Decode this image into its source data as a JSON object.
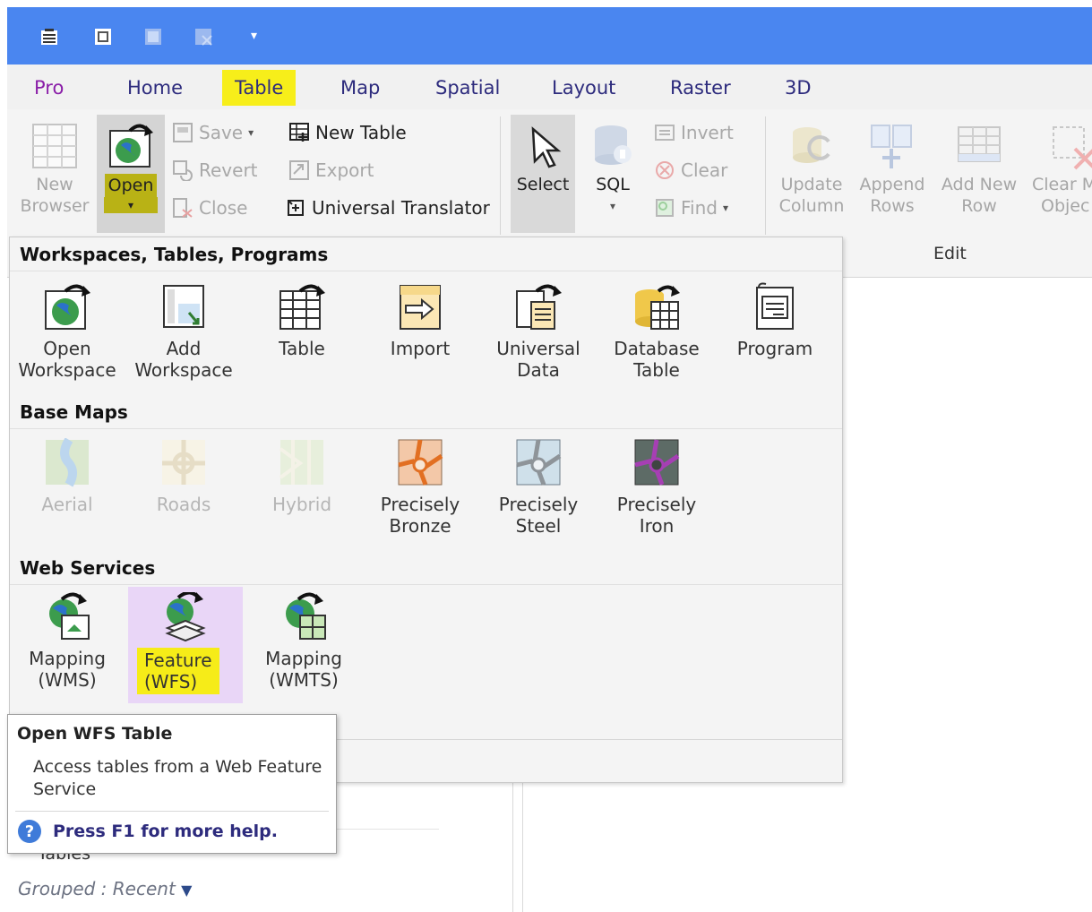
{
  "quick_access": {
    "icons": [
      "open-workspace-icon",
      "save-workspace-icon",
      "save-table-icon",
      "close-table-icon"
    ],
    "dropdown_glyph": "▾"
  },
  "tabs": [
    {
      "label": "Pro"
    },
    {
      "label": "Home"
    },
    {
      "label": "Table"
    },
    {
      "label": "Map"
    },
    {
      "label": "Spatial"
    },
    {
      "label": "Layout"
    },
    {
      "label": "Raster"
    },
    {
      "label": "3D"
    }
  ],
  "active_tab": "Table",
  "ribbon": {
    "new_browser": {
      "line1": "New",
      "line2": "Browser"
    },
    "open": {
      "label": "Open"
    },
    "save": "Save",
    "revert": "Revert",
    "close": "Close",
    "new_table": "New Table",
    "export": "Export",
    "universal_translator": "Universal Translator",
    "select": "Select",
    "sql": "SQL",
    "invert": "Invert",
    "clear": "Clear",
    "find": "Find",
    "update_column": {
      "line1": "Update",
      "line2": "Column"
    },
    "append_rows": {
      "line1": "Append",
      "line2": "Rows"
    },
    "add_new_row": {
      "line1": "Add New",
      "line2": "Row"
    },
    "clear_map_objects": {
      "line1": "Clear M",
      "line2": "Objec"
    },
    "edit_group": "Edit"
  },
  "dropdown": {
    "sections": {
      "workspaces": "Workspaces, Tables, Programs",
      "base_maps": "Base Maps",
      "web_services": "Web Services"
    },
    "workspace_items": [
      {
        "line1": "Open",
        "line2": "Workspace"
      },
      {
        "line1": "Add",
        "line2": "Workspace"
      },
      {
        "line1": "Table",
        "line2": ""
      },
      {
        "line1": "Import",
        "line2": ""
      },
      {
        "line1": "Universal",
        "line2": "Data"
      },
      {
        "line1": "Database",
        "line2": "Table"
      },
      {
        "line1": "Program",
        "line2": ""
      }
    ],
    "basemap_items": [
      {
        "line1": "Aerial",
        "line2": ""
      },
      {
        "line1": "Roads",
        "line2": ""
      },
      {
        "line1": "Hybrid",
        "line2": ""
      },
      {
        "line1": "Precisely",
        "line2": "Bronze"
      },
      {
        "line1": "Precisely",
        "line2": "Steel"
      },
      {
        "line1": "Precisely",
        "line2": "Iron"
      }
    ],
    "web_items": [
      {
        "line1": "Mapping",
        "line2": "(WMS)"
      },
      {
        "line1": "Feature",
        "line2": "(WFS)"
      },
      {
        "line1": "Mapping",
        "line2": "(WMTS)"
      }
    ]
  },
  "tooltip": {
    "title": "Open WFS Table",
    "body": "Access tables from a Web Feature Service",
    "help": "Press F1 for more help."
  },
  "explorer": {
    "tables_label": "Tables",
    "grouped": "Grouped : Recent"
  },
  "colors": {
    "title_bar": "#4a86f0",
    "highlight_yellow": "#f7ee1a",
    "selected_item": "#e9d6f7",
    "tab_text": "#2d2b7d"
  }
}
